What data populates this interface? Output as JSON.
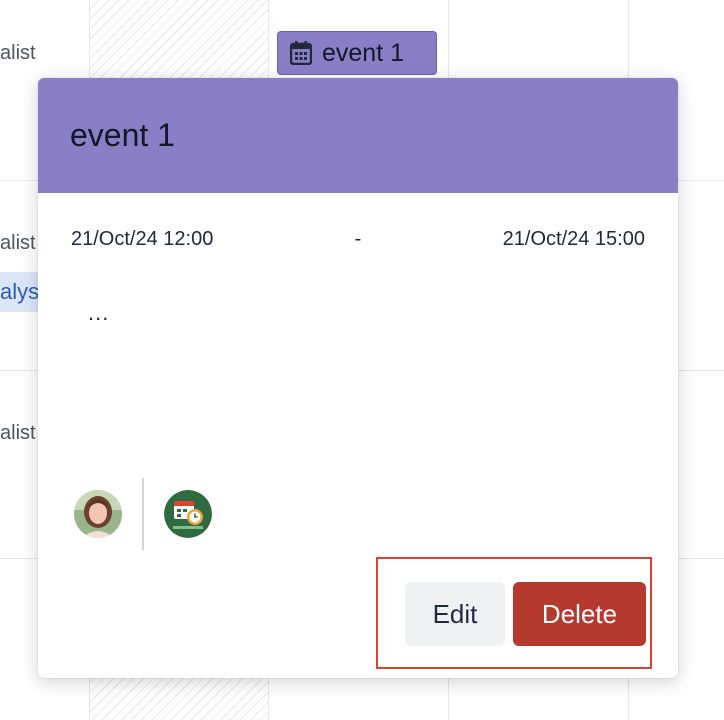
{
  "background": {
    "row_labels": [
      "alist",
      "alist",
      "alist"
    ],
    "highlight_text": "alys",
    "event_chip": {
      "label": "event 1",
      "icon": "calendar-icon"
    }
  },
  "popover": {
    "title": "event 1",
    "start": "21/Oct/24 12:00",
    "separator": "-",
    "end": "21/Oct/24 15:00",
    "description": "...",
    "attendees": [
      {
        "icon": "user-avatar"
      },
      {
        "icon": "calendar-app-logo"
      }
    ],
    "actions": {
      "edit_label": "Edit",
      "delete_label": "Delete"
    }
  },
  "colors": {
    "event": "#8a7ec6",
    "delete": "#b5392f",
    "edit_bg": "#f0f1f3",
    "highlight_outline": "#d9432f"
  }
}
